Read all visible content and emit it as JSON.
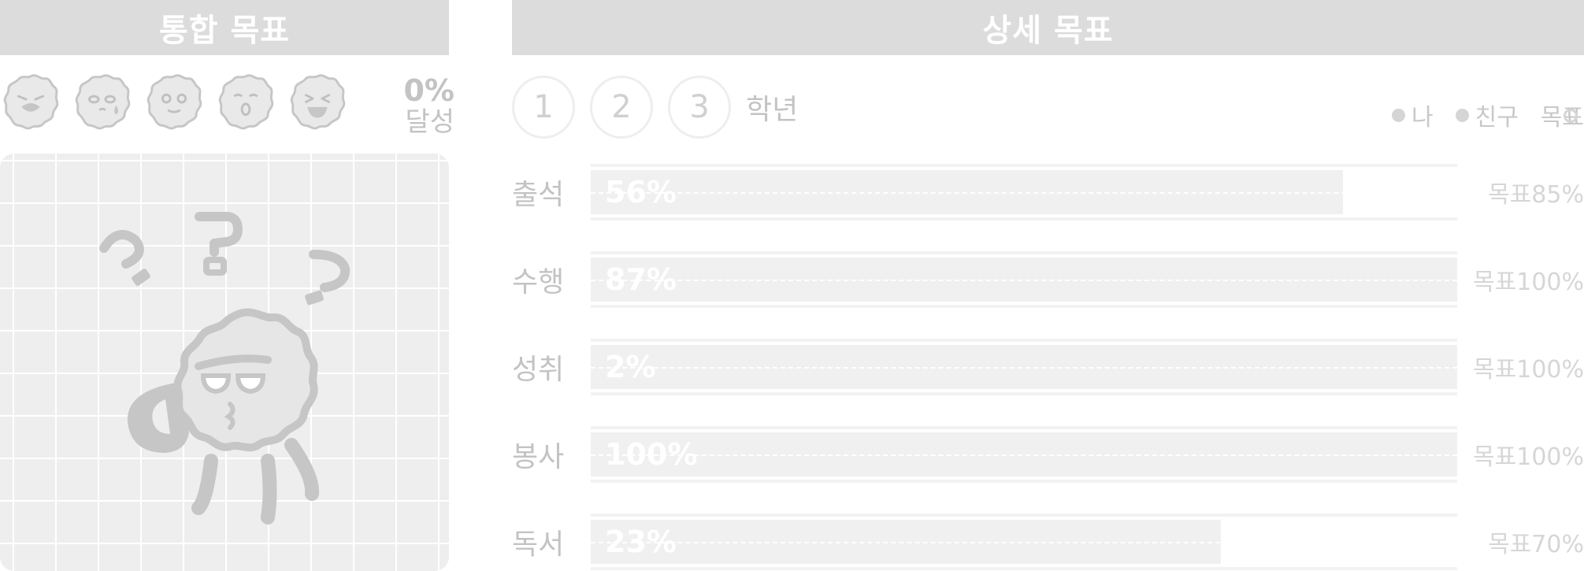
{
  "left_panel": {
    "title": "통합 목표",
    "achievement_value": "0%",
    "achievement_label": "달성",
    "emoji_levels": [
      "crying-face-icon",
      "sweating-face-icon",
      "neutral-face-icon",
      "surprised-face-icon",
      "laughing-face-icon"
    ]
  },
  "right_panel": {
    "title": "상세 목표",
    "grades": [
      "1",
      "2",
      "3"
    ],
    "grade_label": "학년",
    "legend": [
      {
        "label": "나",
        "style": "filled"
      },
      {
        "label": "친구",
        "style": "filled"
      },
      {
        "label": "목표",
        "style": "outline"
      }
    ],
    "goals": [
      {
        "category": "출석",
        "value_label": "56%",
        "progress": 0.868,
        "goal_label": "목표85%"
      },
      {
        "category": "수행",
        "value_label": "87%",
        "progress": 1.0,
        "goal_label": "목표100%"
      },
      {
        "category": "성취",
        "value_label": "2%",
        "progress": 1.0,
        "goal_label": "목표100%"
      },
      {
        "category": "봉사",
        "value_label": "100%",
        "progress": 1.0,
        "goal_label": "목표100%"
      },
      {
        "category": "독서",
        "value_label": "23%",
        "progress": 0.727,
        "goal_label": "목표70%"
      }
    ]
  },
  "colors": {
    "header_bg": "#dcdcdc",
    "bar_fill": "#f0f0f0",
    "text_muted": "#c3c3c3"
  }
}
